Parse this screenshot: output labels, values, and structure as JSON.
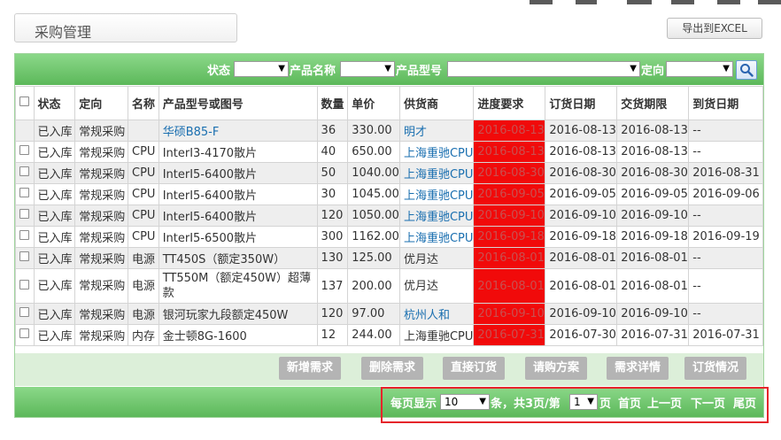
{
  "page": {
    "title": "采购管理",
    "export_label": "导出到EXCEL"
  },
  "filters": {
    "status_label": "状态",
    "product_name_label": "产品名称",
    "product_model_label": "产品型号",
    "direction_label": "定向",
    "status_value": "",
    "product_name_value": "",
    "product_model_value": "",
    "direction_value": ""
  },
  "table": {
    "headers": [
      "状态",
      "定向",
      "名称",
      "产品型号或图号",
      "数量",
      "单价",
      "供货商",
      "进度要求",
      "订货日期",
      "交货期限",
      "到货日期"
    ],
    "rows": [
      {
        "status": "已入库",
        "direction": "常规采购",
        "name": "",
        "model": "华硕B85-F",
        "qty": "36",
        "price": "330.00",
        "supplier": "明才",
        "progress": "2016-08-13",
        "order_date": "2016-08-13",
        "deadline": "2016-08-13",
        "arrival": "--"
      },
      {
        "status": "已入库",
        "direction": "常规采购",
        "name": "CPU",
        "model": "InterI3-4170散片",
        "qty": "40",
        "price": "650.00",
        "supplier": "上海重驰CPU",
        "progress": "2016-08-13",
        "order_date": "2016-08-13",
        "deadline": "2016-08-13",
        "arrival": "--"
      },
      {
        "status": "已入库",
        "direction": "常规采购",
        "name": "CPU",
        "model": "InterI5-6400散片",
        "qty": "50",
        "price": "1040.00",
        "supplier": "上海重驰CPU",
        "progress": "2016-08-30",
        "order_date": "2016-08-30",
        "deadline": "2016-08-30",
        "arrival": "2016-08-31"
      },
      {
        "status": "已入库",
        "direction": "常规采购",
        "name": "CPU",
        "model": "InterI5-6400散片",
        "qty": "30",
        "price": "1045.00",
        "supplier": "上海重驰CPU",
        "progress": "2016-09-05",
        "order_date": "2016-09-05",
        "deadline": "2016-09-05",
        "arrival": "2016-09-06"
      },
      {
        "status": "已入库",
        "direction": "常规采购",
        "name": "CPU",
        "model": "InterI5-6400散片",
        "qty": "120",
        "price": "1050.00",
        "supplier": "上海重驰CPU",
        "progress": "2016-09-10",
        "order_date": "2016-09-10",
        "deadline": "2016-09-10",
        "arrival": "--"
      },
      {
        "status": "已入库",
        "direction": "常规采购",
        "name": "CPU",
        "model": "InterI5-6500散片",
        "qty": "300",
        "price": "1162.00",
        "supplier": "上海重驰CPU",
        "progress": "2016-09-18",
        "order_date": "2016-09-18",
        "deadline": "2016-09-18",
        "arrival": "2016-09-19"
      },
      {
        "status": "已入库",
        "direction": "常规采购",
        "name": "电源",
        "model": "TT450S（额定350W）",
        "qty": "130",
        "price": "125.00",
        "supplier": "优月达",
        "progress": "2016-08-01",
        "order_date": "2016-08-01",
        "deadline": "2016-08-01",
        "arrival": "--"
      },
      {
        "status": "已入库",
        "direction": "常规采购",
        "name": "电源",
        "model": "TT550M（额定450W）超薄款",
        "qty": "137",
        "price": "200.00",
        "supplier": "优月达",
        "progress": "2016-08-01",
        "order_date": "2016-08-01",
        "deadline": "2016-08-01",
        "arrival": "--"
      },
      {
        "status": "已入库",
        "direction": "常规采购",
        "name": "电源",
        "model": "银河玩家九段额定450W",
        "qty": "120",
        "price": "97.00",
        "supplier": "杭州人和",
        "progress": "2016-09-10",
        "order_date": "2016-09-10",
        "deadline": "2016-09-10",
        "arrival": "--"
      },
      {
        "status": "已入库",
        "direction": "常规采购",
        "name": "内存",
        "model": "金士顿8G-1600",
        "qty": "12",
        "price": "244.00",
        "supplier": "上海重驰CPU",
        "progress": "2016-07-31",
        "order_date": "2016-07-30",
        "deadline": "2016-07-31",
        "arrival": "2016-07-31"
      }
    ]
  },
  "actions": {
    "new_request": "新增需求",
    "delete_request": "删除需求",
    "direct_order": "直接订货",
    "purchase_plan": "请购方案",
    "request_detail": "需求详情",
    "order_status": "订货情况"
  },
  "pager": {
    "per_page_label": "每页显示",
    "per_page_value": "10",
    "summary_label": "条，共3页/第",
    "page_value": "1",
    "page_suffix": "页",
    "first": "首页",
    "prev": "上一页",
    "next": "下一页",
    "last": "尾页"
  },
  "colors": {
    "green_bar": "#5cb85a",
    "overdue_red": "#f10a0a",
    "link_blue": "#1a6fb0",
    "highlight_red": "#e5262b"
  }
}
